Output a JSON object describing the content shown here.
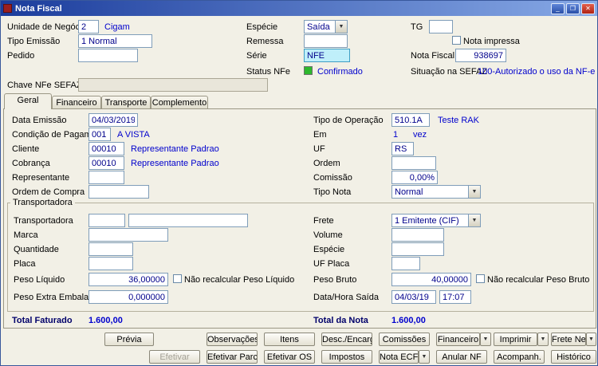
{
  "window": {
    "title": "Nota Fiscal"
  },
  "icons": {
    "dropdown_arrow": "▼",
    "minimize": "_",
    "maximize": "❐",
    "close": "✕"
  },
  "header": {
    "unidade": {
      "label": "Unidade de Negócio",
      "value": "2",
      "desc": "Cigam"
    },
    "especie": {
      "label": "Espécie",
      "value": "Saída"
    },
    "tg": {
      "label": "TG",
      "value": ""
    },
    "tipo_emissao": {
      "label": "Tipo Emissão",
      "value": "1 Normal"
    },
    "remessa": {
      "label": "Remessa",
      "value": ""
    },
    "nota_impressa": {
      "label": "Nota impressa"
    },
    "pedido": {
      "label": "Pedido",
      "value": ""
    },
    "serie": {
      "label": "Série",
      "value": "NFE"
    },
    "nota_fiscal": {
      "label": "Nota Fiscal",
      "value": "938697"
    },
    "status_nfe": {
      "label": "Status NFe",
      "value": "Confirmado"
    },
    "sefaz": {
      "label": "Situação na SEFAZ",
      "value": "100-Autorizado o uso da NF-e"
    },
    "chave": {
      "label": "Chave NFe SEFAZ",
      "value": ""
    }
  },
  "tabs": [
    {
      "label": "Geral"
    },
    {
      "label": "Financeiro"
    },
    {
      "label": "Transporte"
    },
    {
      "label": "Complemento"
    }
  ],
  "geral": {
    "data_emissao": {
      "label": "Data Emissão",
      "value": "04/03/2019"
    },
    "cond_pag": {
      "label": "Condição de Pagamento",
      "value": "001",
      "desc": "A VISTA"
    },
    "cliente": {
      "label": "Cliente",
      "value": "00010",
      "desc": "Representante Padrao"
    },
    "cobranca": {
      "label": "Cobrança",
      "value": "00010",
      "desc": "Representante Padrao"
    },
    "representante": {
      "label": "Representante",
      "value": ""
    },
    "ordem_compra": {
      "label": "Ordem de Compra",
      "value": ""
    },
    "tipo_operacao": {
      "label": "Tipo de Operação",
      "value": "510.1A",
      "desc": "Teste RAK"
    },
    "em": {
      "label": "Em",
      "value": "1",
      "desc": "vez"
    },
    "uf": {
      "label": "UF",
      "value": "RS"
    },
    "ordem": {
      "label": "Ordem",
      "value": ""
    },
    "comissao": {
      "label": "Comissão",
      "value": "0,00%"
    },
    "tipo_nota": {
      "label": "Tipo Nota",
      "value": "Normal"
    }
  },
  "transp": {
    "group": "Transportadora",
    "transportadora": {
      "label": "Transportadora",
      "code": "",
      "name": ""
    },
    "marca": {
      "label": "Marca",
      "value": ""
    },
    "quantidade": {
      "label": "Quantidade",
      "value": ""
    },
    "placa": {
      "label": "Placa",
      "value": ""
    },
    "peso_liquido": {
      "label": "Peso Líquido",
      "value": "36,00000",
      "chk": "Não recalcular Peso Líquido"
    },
    "peso_extra": {
      "label": "Peso Extra Embalagem",
      "value": "0,000000"
    },
    "frete": {
      "label": "Frete",
      "value": "1 Emitente (CIF)"
    },
    "volume": {
      "label": "Volume",
      "value": ""
    },
    "especie": {
      "label": "Espécie",
      "value": ""
    },
    "uf_placa": {
      "label": "UF Placa",
      "value": ""
    },
    "peso_bruto": {
      "label": "Peso Bruto",
      "value": "40,00000",
      "chk": "Não recalcular Peso Bruto"
    },
    "saida": {
      "label": "Data/Hora Saída",
      "date": "04/03/19",
      "time": "17:07"
    }
  },
  "totals": {
    "faturado": {
      "label": "Total Faturado",
      "value": "1.600,00"
    },
    "nota": {
      "label": "Total da Nota",
      "value": "1.600,00"
    }
  },
  "buttons": {
    "previa": "Prévia",
    "observacoes": "Observações",
    "itens": "Itens",
    "desc_encargos": "Desc./Encargos",
    "comissoes": "Comissões",
    "financeiro": "Financeiro",
    "imprimir": "Imprimir",
    "frete_neg": "Frete Neg.",
    "efetivar": "Efetivar",
    "efetivar_parcial": "Efetivar Parcial",
    "efetivar_os": "Efetivar OS",
    "impostos": "Impostos",
    "nota_ecf": "Nota ECF",
    "anular_nf": "Anular NF",
    "acompanh": "Acompanh.",
    "historico": "Histórico"
  }
}
